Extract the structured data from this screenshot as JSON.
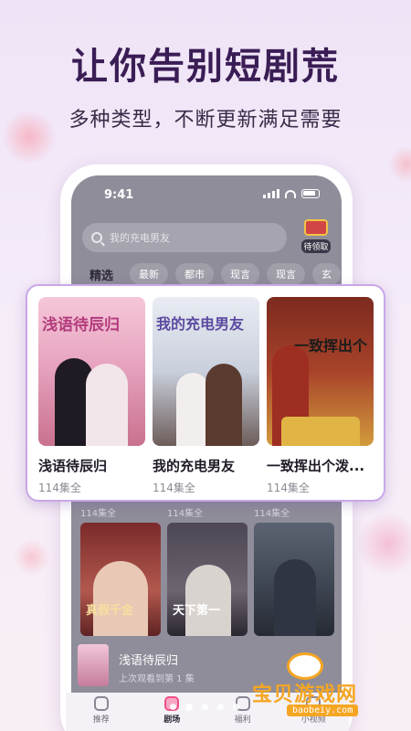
{
  "hero": {
    "title": "让你告别短剧荒",
    "subtitle": "多种类型，不断更新满足需要"
  },
  "status_bar": {
    "time": "9:41"
  },
  "search": {
    "placeholder": "我的充电男友"
  },
  "reward": {
    "label": "待领取"
  },
  "tabs": [
    {
      "label": "精选",
      "active": true
    },
    {
      "label": "最新"
    },
    {
      "label": "都市"
    },
    {
      "label": "现言"
    },
    {
      "label": "现言"
    },
    {
      "label": "玄"
    }
  ],
  "featured": [
    {
      "title": "浅语待辰归",
      "poster_text": "浅语待辰归",
      "meta": "114集全"
    },
    {
      "title": "我的充电男友",
      "poster_text": "我的充电男友",
      "meta": "114集全"
    },
    {
      "title": "一致挥出个泼...",
      "poster_text": "一致挥出个泼",
      "meta": "114集全"
    }
  ],
  "second_row": [
    {
      "meta": "114集全",
      "poster_text": "真假千金"
    },
    {
      "meta": "114集全",
      "poster_text": "天下第一"
    },
    {
      "meta": "114集全",
      "poster_text": ""
    }
  ],
  "history": {
    "title": "浅语待辰归",
    "subtitle": "上次观看到第 1 集"
  },
  "bottom_nav": [
    {
      "label": "推荐"
    },
    {
      "label": "剧场",
      "active": true
    },
    {
      "label": "福利"
    },
    {
      "label": "小视频"
    }
  ],
  "carousel": {
    "count": 5,
    "active_index": 1
  },
  "watermark": {
    "text": "宝贝游戏网",
    "url": "baobeiy.com"
  },
  "colors": {
    "title": "#3a1d55",
    "accent": "#f0508a",
    "card_border": "#c9a7e8",
    "watermark": "#f5a623"
  }
}
